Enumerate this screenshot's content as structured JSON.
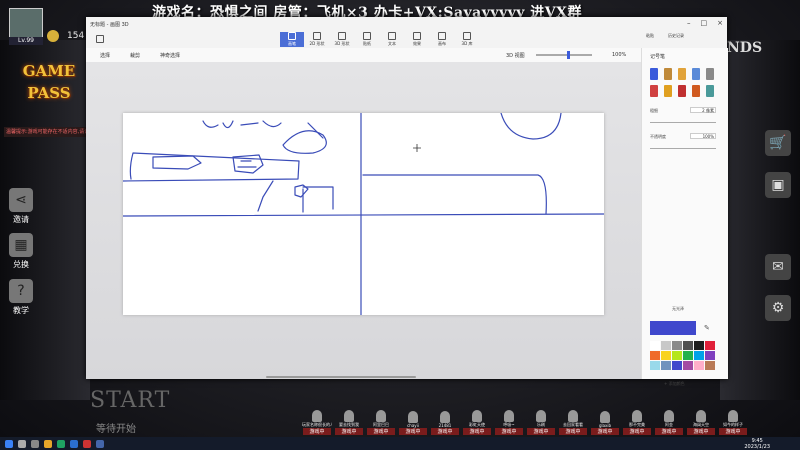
{
  "stream": {
    "title": "游戏名：恐惧之间    房管：飞机×3     办卡+VX:Sayayyyyy 进VX群",
    "avatar_level": "Lv.99",
    "coin_count": "154",
    "game_pass": [
      "GAME",
      "PASS"
    ],
    "notice": "温馨提示:游戏可能存在不适内容,请谨慎游玩",
    "side_buttons": [
      {
        "label": "邀请",
        "icon": "share-icon",
        "glyph": "⋖"
      },
      {
        "label": "兑换",
        "icon": "qr-code-icon",
        "glyph": "▦"
      },
      {
        "label": "教学",
        "icon": "help-icon",
        "glyph": "?"
      }
    ],
    "right_buttons": [
      {
        "icon": "cart-icon",
        "glyph": "🛒"
      },
      {
        "icon": "card-icon",
        "glyph": "▣"
      },
      {
        "icon": "mail-icon",
        "glyph": "✉"
      },
      {
        "icon": "settings-icon",
        "glyph": "⚙"
      }
    ],
    "logo_partial": "NDS",
    "start_label": "START",
    "waiting_label": "等待开始"
  },
  "players": [
    {
      "name": "玩家名称很长的人",
      "status": "游戏中"
    },
    {
      "name": "要去找到我",
      "status": "游戏中"
    },
    {
      "name": "阿里巴巴",
      "status": "游戏中"
    },
    {
      "name": "chayii",
      "status": "游戏中"
    },
    {
      "name": "21481",
      "status": "游戏中"
    },
    {
      "name": "彩虹天使",
      "status": "游戏中"
    },
    {
      "name": "呼吸~",
      "status": "游戏中"
    },
    {
      "name": "乐刷",
      "status": "游戏中"
    },
    {
      "name": "去回家看看",
      "status": "游戏中"
    },
    {
      "name": "glaxib",
      "status": "游戏中"
    },
    {
      "name": "那不完美",
      "status": "游戏中"
    },
    {
      "name": "阿金",
      "status": "游戏中"
    },
    {
      "name": "海阔天空",
      "status": "游戏中"
    },
    {
      "name": "如今的样子",
      "status": "游戏中"
    }
  ],
  "paint": {
    "window_title": "无标题 - 画图 3D",
    "ribbon": [
      {
        "label": "画笔",
        "active": true
      },
      {
        "label": "2D 形状",
        "active": false
      },
      {
        "label": "3D 形状",
        "active": false
      },
      {
        "label": "贴纸",
        "active": false
      },
      {
        "label": "文本",
        "active": false
      },
      {
        "label": "效果",
        "active": false
      },
      {
        "label": "画布",
        "active": false
      },
      {
        "label": "3D 库",
        "active": false
      }
    ],
    "ribbon_right": [
      "粘贴",
      "历史记录"
    ],
    "toolbar": {
      "select": "选择",
      "crop": "裁剪",
      "magic_select": "神奇选择",
      "view_3d": "3D 视图",
      "zoom": "100%"
    },
    "panel": {
      "title": "记号笔",
      "thickness_label": "粗细",
      "thickness_value": "2 像素",
      "opacity_label": "不透明度",
      "opacity_value": "100%",
      "finish_label": "无光泽",
      "add_color": "添加颜色",
      "swatches": [
        "#ffffff",
        "#c8c8c8",
        "#8a8a8a",
        "#505050",
        "#1e1e1e",
        "#e0203a",
        "#ef6a2a",
        "#f8d320",
        "#b5e61d",
        "#22b14c",
        "#00a2e8",
        "#7f3fbf",
        "#99d9ea",
        "#7092be",
        "#3f48cc",
        "#a349a4",
        "#ffaec9",
        "#b97a57"
      ],
      "current_color": "#3f48cc"
    }
  },
  "taskbar": {
    "time": "9:45",
    "date": "2023/1/23"
  }
}
